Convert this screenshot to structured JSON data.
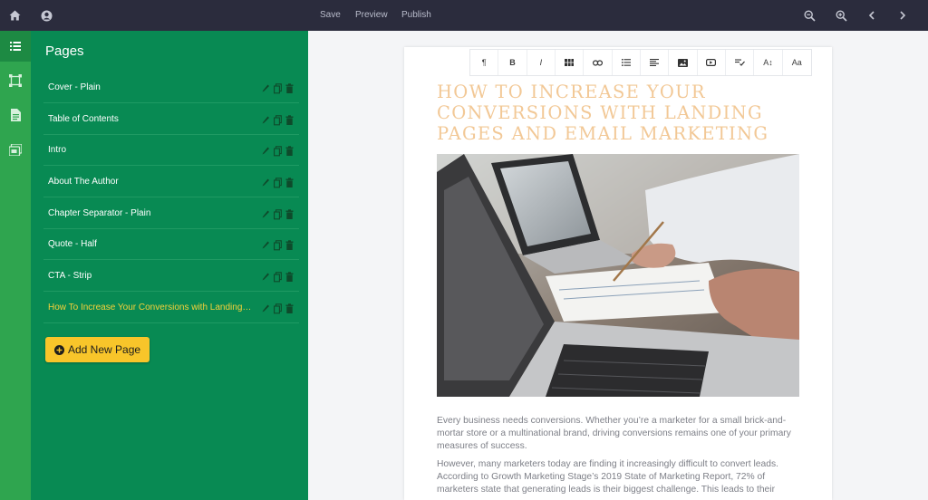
{
  "toolbar": {
    "save_label": "Save",
    "preview_label": "Preview",
    "publish_label": "Publish"
  },
  "sidebar": {
    "title": "Pages",
    "pages": [
      {
        "label": "Cover - Plain"
      },
      {
        "label": "Table of Contents"
      },
      {
        "label": "Intro"
      },
      {
        "label": "About The Author"
      },
      {
        "label": "Chapter Separator - Plain"
      },
      {
        "label": "Quote - Half"
      },
      {
        "label": "CTA - Strip"
      },
      {
        "label": "How To Increase Your Conversions with Landing Pages and Email Marketing",
        "active": true
      }
    ],
    "add_page_label": "Add New Page"
  },
  "format_bar": [
    "¶",
    "B",
    "I",
    "table",
    "link",
    "list",
    "align",
    "image",
    "video",
    "spellcheck",
    "A↕",
    "Aa"
  ],
  "document": {
    "title": "How To Increase Your Conversions with Landing Pages and Email Marketing",
    "paragraph_1": "Every business needs conversions. Whether you’re a marketer for a small brick-and-mortar store or a multinational brand, driving conversions remains one of your primary measures of success.",
    "paragraph_2": "However, many marketers today are finding it increasingly difficult to convert leads. According to Growth Marketing Stage’s 2019 State of Marketing Report, 72% of marketers state that generating leads is their biggest challenge. This leads to their"
  },
  "colors": {
    "topbar": "#2b2c3d",
    "rail": "#2fa54f",
    "panel": "#088a53",
    "active_page": "#f6d13a",
    "add_button": "#f8c52a",
    "title": "#f2c896"
  }
}
